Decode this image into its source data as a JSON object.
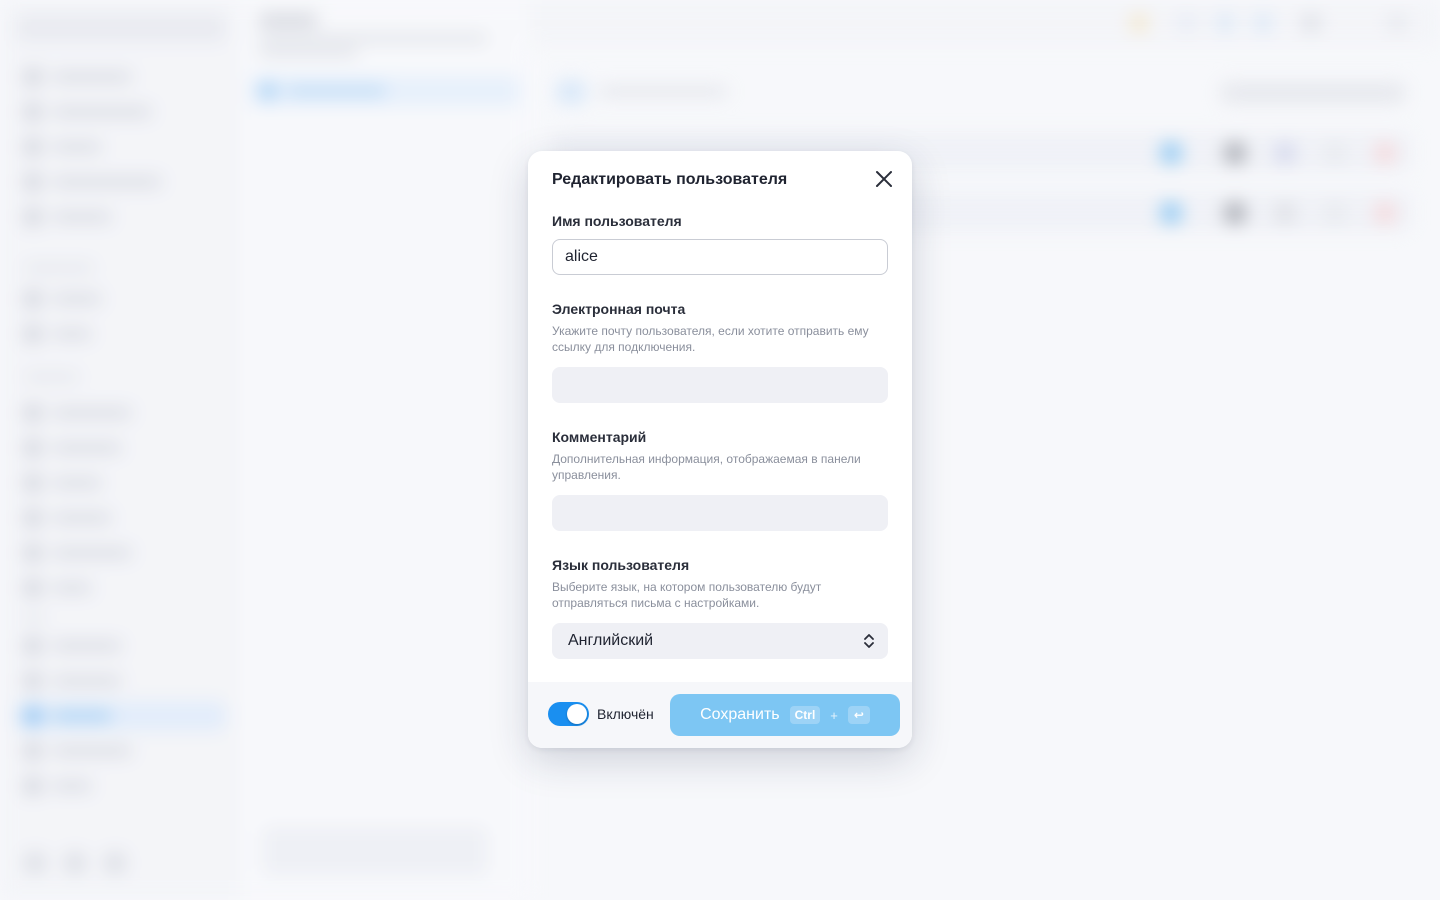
{
  "modal": {
    "title": "Редактировать пользователя",
    "username": {
      "label": "Имя пользователя",
      "value": "alice"
    },
    "email": {
      "label": "Электронная почта",
      "help": "Укажите почту пользователя, если хотите отправить ему ссылку для подключения.",
      "value": ""
    },
    "comment": {
      "label": "Комментарий",
      "help": "Дополнительная информация, отображаемая в панели управления.",
      "value": ""
    },
    "language": {
      "label": "Язык пользователя",
      "help": "Выберите язык, на котором пользователю будут отправляться письма с настройками.",
      "selected": "Английский"
    },
    "footer": {
      "toggle_label": "Включён",
      "toggle_on": true,
      "save_label": "Сохранить",
      "shortcut_ctrl": "Ctrl",
      "shortcut_plus": "+",
      "shortcut_enter": "↩"
    }
  },
  "colors": {
    "accent": "#1a8ff0",
    "save_button": "#7dc6f3",
    "input_fill": "#eff0f5"
  },
  "icons": {
    "close": "close-icon",
    "select_chevron": "chevron-up-down-icon",
    "enter": "enter-key-icon"
  }
}
